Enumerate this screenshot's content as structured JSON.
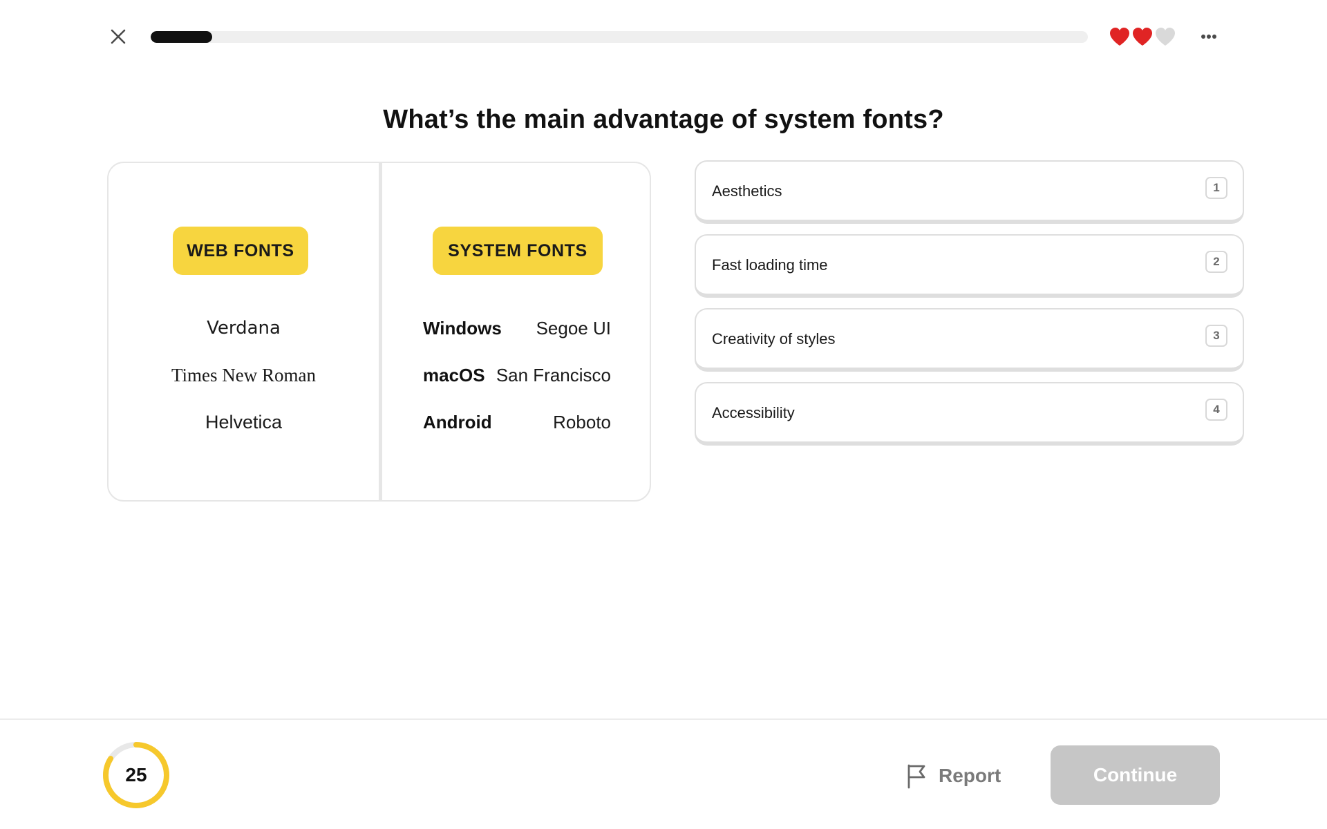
{
  "header": {
    "progress_fraction": 0.066,
    "progress_color": "#111111",
    "lives": {
      "total": 3,
      "remaining": 2,
      "full_color": "#e02424",
      "empty_color": "#d9d9d9"
    }
  },
  "question": {
    "text": "What’s the main advantage of system fonts?"
  },
  "comparison": {
    "web_fonts": {
      "label": "WEB FONTS",
      "fonts": [
        "Verdana",
        "Times New Roman",
        "Helvetica"
      ]
    },
    "system_fonts": {
      "label": "SYSTEM FONTS",
      "rows": [
        {
          "os": "Windows",
          "font": "Segoe UI"
        },
        {
          "os": "macOS",
          "font": "San Francisco"
        },
        {
          "os": "Android",
          "font": "Roboto"
        }
      ]
    },
    "pill_color": "#f7d53f"
  },
  "answers": [
    {
      "label": "Aesthetics",
      "key": "1"
    },
    {
      "label": "Fast loading time",
      "key": "2"
    },
    {
      "label": "Creativity of styles",
      "key": "3"
    },
    {
      "label": "Accessibility",
      "key": "4"
    }
  ],
  "footer": {
    "timer": {
      "value": "25",
      "ring_fraction": 0.84,
      "ring_color": "#f6c82c",
      "track_color": "#e8e8e8"
    },
    "report_label": "Report",
    "continue_label": "Continue"
  },
  "icons": {
    "close": "close-icon",
    "more": "more-icon",
    "heart": "heart-icon",
    "report": "flag-icon"
  }
}
